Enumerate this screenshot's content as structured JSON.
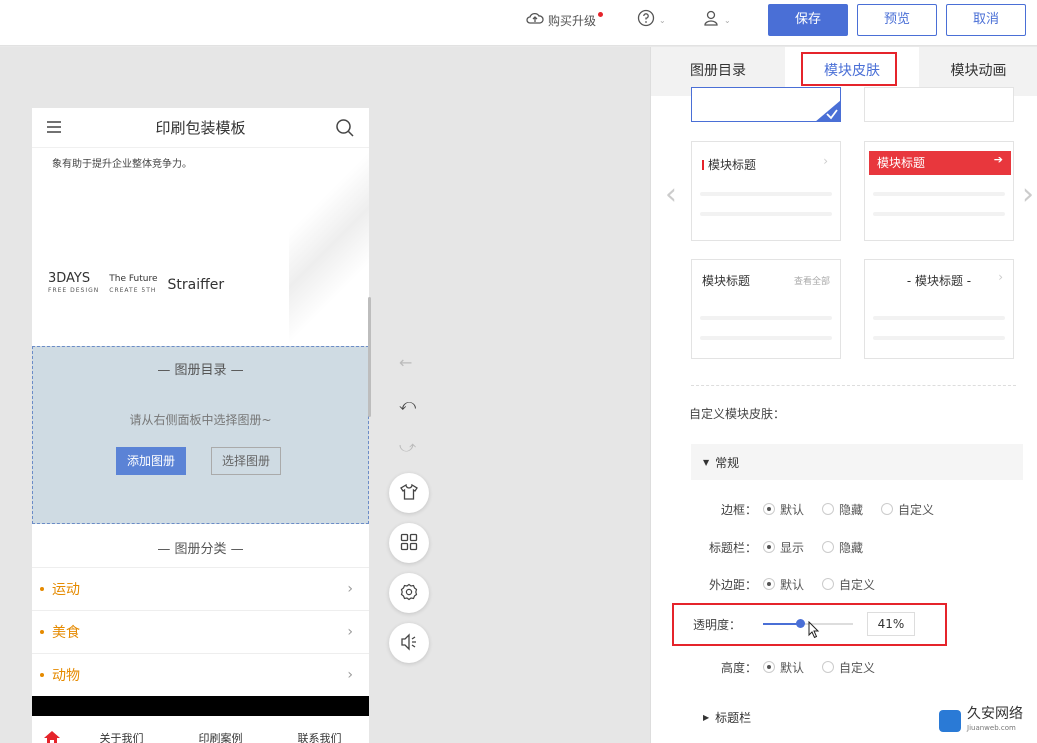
{
  "topbar": {
    "upgrade_label": "购买升级",
    "save_label": "保存",
    "preview_label": "预览",
    "cancel_label": "取消"
  },
  "phone": {
    "title": "印刷包装模板",
    "intro_text": "象有助于提升企业整体竞争力。",
    "brands": [
      {
        "name": "3DAYS",
        "sub": "FREE DESIGN"
      },
      {
        "name": "The Future",
        "sub": "CREATE 5TH"
      },
      {
        "name": "Straiffer",
        "sub": ""
      }
    ],
    "album_title": "图册目录",
    "album_hint": "请从右侧面板中选择图册~",
    "add_album": "添加图册",
    "select_album": "选择图册",
    "category_title": "图册分类",
    "categories": [
      "运动",
      "美食",
      "动物"
    ],
    "nav": [
      "关于我们",
      "印刷案例",
      "联系我们"
    ]
  },
  "panel": {
    "tabs": [
      "图册目录",
      "模块皮肤",
      "模块动画"
    ],
    "skins": [
      {
        "label": "模块标题",
        "extra": ""
      },
      {
        "label": "模块标题",
        "extra": ""
      },
      {
        "label": "模块标题",
        "extra": "查看全部"
      },
      {
        "label": "- 模块标题 -",
        "extra": ""
      }
    ],
    "custom_label": "自定义模块皮肤：",
    "group_general": "常规",
    "border": {
      "label": "边框：",
      "options": [
        "默认",
        "隐藏",
        "自定义"
      ]
    },
    "titlebar": {
      "label": "标题栏：",
      "options": [
        "显示",
        "隐藏"
      ]
    },
    "margin": {
      "label": "外边距：",
      "options": [
        "默认",
        "自定义"
      ]
    },
    "opacity": {
      "label": "透明度：",
      "value": "41%",
      "level": 0.41
    },
    "height": {
      "label": "高度：",
      "options": [
        "默认",
        "自定义"
      ]
    },
    "group_titlebar": "标题栏"
  },
  "watermark": {
    "name": "久安网络",
    "url": "Jiuanweb.com"
  },
  "colors": {
    "accent": "#4a6fd6",
    "highlight": "#e5242b",
    "category": "#e58a00"
  }
}
